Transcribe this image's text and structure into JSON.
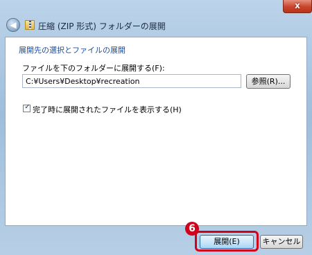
{
  "window": {
    "title": "圧縮 (ZIP 形式) フォルダーの展開",
    "close_glyph": "x",
    "back_glyph": "◀"
  },
  "content": {
    "heading": "展開先の選択とファイルの展開",
    "target_label": "ファイルを下のフォルダーに展開する(F):",
    "target_path": "C:¥Users¥Desktop¥recreation",
    "browse_label": "参照(R)...",
    "show_files_label": "完了時に展開されたファイルを表示する(H)",
    "show_files_checked": true,
    "check_glyph": "✓"
  },
  "footer": {
    "extract_label": "展開(E)",
    "cancel_label": "キャンセル"
  },
  "annotation": {
    "step_badge": "6",
    "highlight_color": "#d0021b"
  }
}
